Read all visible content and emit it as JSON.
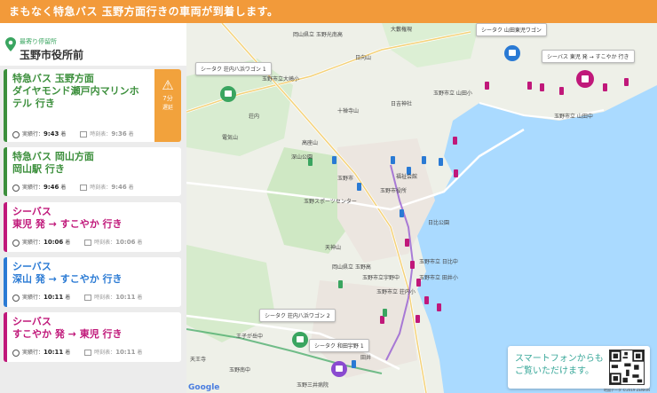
{
  "banner": {
    "text": "まもなく特急バス 玉野方面行きの車両が到着します。"
  },
  "stop": {
    "caption": "最寄り停留所",
    "name": "玉野市役所前"
  },
  "labels": {
    "actual": "実績行：",
    "scheduled": "時刻表："
  },
  "cards": [
    {
      "title_line1": "特急バス 玉野方面",
      "title_line2": "ダイヤモンド瀬戸内マリンホ",
      "title_line3": "テル 行き",
      "actual_time": "9:43",
      "scheduled_time": "9:36",
      "accent": "#3c8f3c",
      "delay": {
        "icon": "warning-icon",
        "minutes": "7分",
        "label": "遅延"
      }
    },
    {
      "title_line1": "特急バス 岡山方面",
      "title_line2": "岡山駅 行き",
      "actual_time": "9:46",
      "scheduled_time": "9:46",
      "accent": "#3c8f3c"
    },
    {
      "title_line1": "シーバス",
      "title_line2": "東児 発 → すこやか 行き",
      "actual_time": "10:06",
      "scheduled_time": "10:06",
      "accent": "#c0187a"
    },
    {
      "title_line1": "シーバス",
      "title_line2": "深山 発 → すこやか 行き",
      "actual_time": "10:11",
      "scheduled_time": "10:11",
      "accent": "#2a7ad4"
    },
    {
      "title_line1": "シーバス",
      "title_line2": "すこやか 発 → 東児 行き",
      "actual_time": "10:11",
      "scheduled_time": "10:11",
      "accent": "#c0187a"
    }
  ],
  "time_suffix": "着",
  "map": {
    "callouts": [
      "シータク 山田東児ワゴン",
      "シータク 荘内八浜ワゴン 1",
      "シーバス 東児 発 → すこやか 行き",
      "シータク 荘内八浜ワゴン 2",
      "シータク 和田宇野 1"
    ],
    "places": [
      "岡山県立 玉野光南高",
      "大藪権現",
      "日向山",
      "玉野市立大崎小",
      "玉野市立 山田小",
      "日吉神社",
      "十禅寺山",
      "荘内",
      "電気山",
      "高座山",
      "深山公園",
      "玉野市",
      "玉野市役所",
      "福祉会館",
      "玉野スポーツセンター",
      "日比公園",
      "天神山",
      "岡山県立 玉野高",
      "玉野市立宇野中",
      "玉野市立 荘内小",
      "王子が岳中",
      "天王寺",
      "田井",
      "玉野三井病院",
      "玉野市立 日比中",
      "玉野市立 田井小",
      "玉野市立 山田中",
      "玉野南中"
    ],
    "google": "Google",
    "copyright": "地図データ ©2019 ZENRIN"
  },
  "promo": {
    "line1": "スマートフォンからも",
    "line2": "ご覧いただけます。"
  },
  "colors": {
    "banner": "#f29a3a",
    "green": "#3c8f3c",
    "magenta": "#c0187a",
    "blue": "#2a7ad4",
    "delay": "#f2a23c",
    "sea": "#aadaff"
  }
}
